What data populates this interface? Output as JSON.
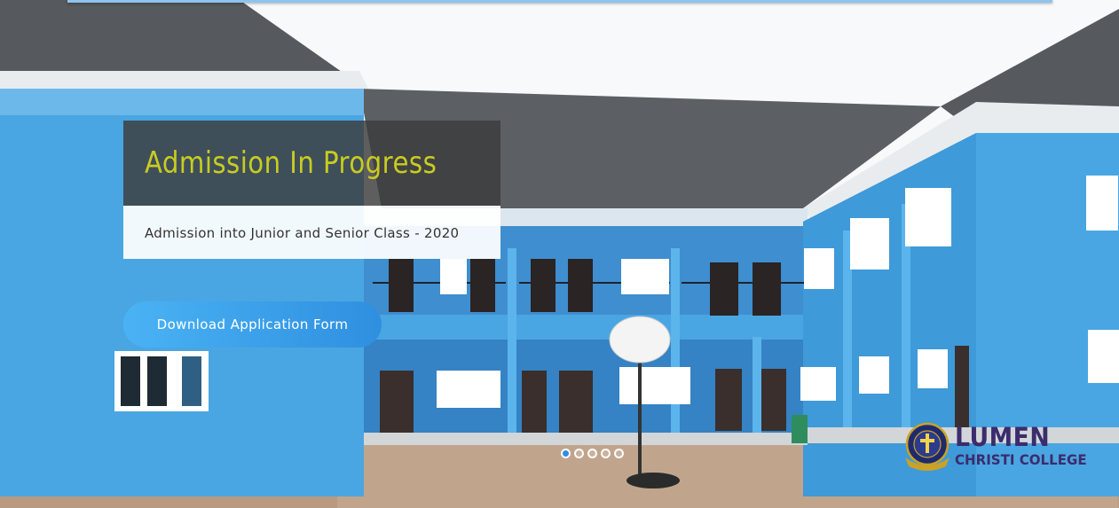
{
  "slide": {
    "title": "Admission In Progress",
    "subtitle": "Admission into Junior and Senior Class - 2020",
    "cta_label": "Download Application Form"
  },
  "carousel": {
    "slide_count": 5,
    "active_index": 0
  },
  "logo": {
    "line1": "LUMEN",
    "line2": "CHRISTI COLLEGE",
    "icon": "school-crest-icon"
  },
  "colors": {
    "title": "#c9cc1f",
    "cta_start": "#4ab3f4",
    "cta_end": "#2f8fe0",
    "building_blue": "#4aa6e2",
    "logo": "#3b2c6e"
  }
}
